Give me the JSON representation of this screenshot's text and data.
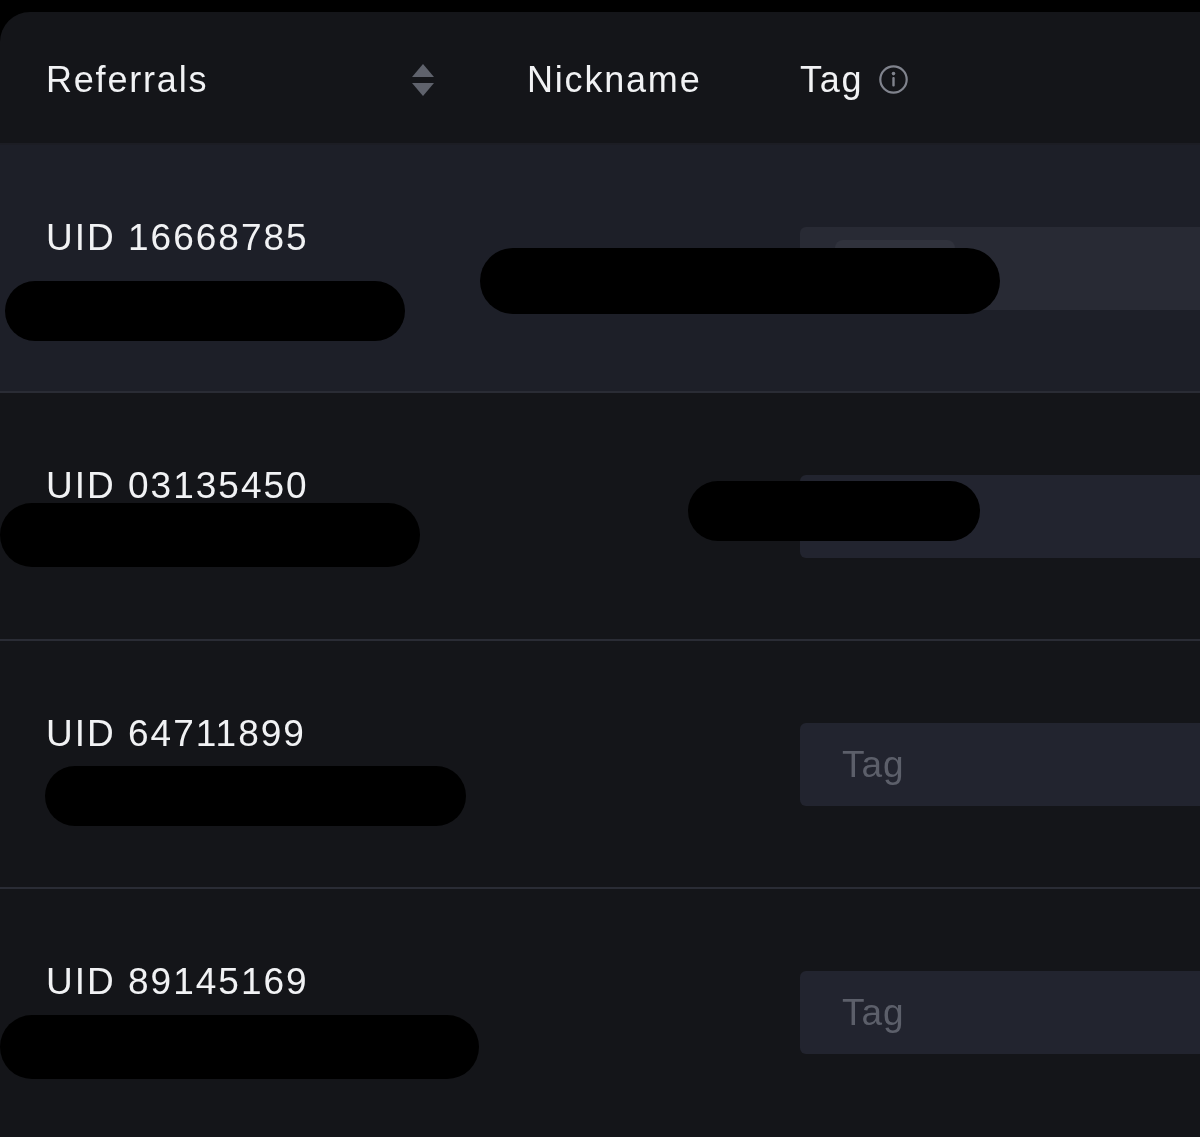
{
  "table": {
    "columns": [
      {
        "label": "Referrals",
        "sortable": true,
        "info": false
      },
      {
        "label": "Nickname",
        "sortable": false,
        "info": false
      },
      {
        "label": "Tag",
        "sortable": false,
        "info": true
      }
    ],
    "rows": [
      {
        "uid": "UID 16668785",
        "highlighted": true,
        "note_redacted": true,
        "nickname_redacted": true,
        "tag": {
          "kind": "chip"
        }
      },
      {
        "uid": "UID 03135450",
        "highlighted": false,
        "note_redacted": true,
        "nickname_redacted": true,
        "tag": {
          "kind": "blank"
        }
      },
      {
        "uid": "UID 64711899",
        "highlighted": false,
        "note_redacted": true,
        "nickname_redacted": false,
        "tag": {
          "kind": "placeholder",
          "placeholder": "Tag"
        }
      },
      {
        "uid": "UID 89145169",
        "highlighted": false,
        "note_redacted": true,
        "nickname_redacted": false,
        "tag": {
          "kind": "placeholder",
          "placeholder": "Tag"
        }
      }
    ]
  }
}
